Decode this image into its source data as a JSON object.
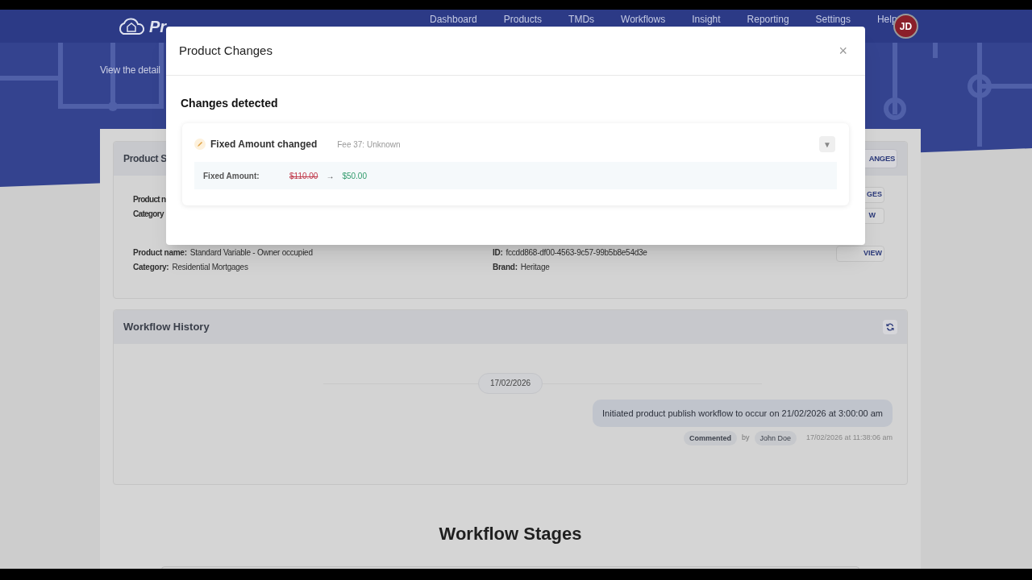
{
  "header": {
    "logo": "Pr",
    "nav": [
      "Dashboard",
      "Products",
      "TMDs",
      "Workflows",
      "Insight",
      "Reporting",
      "Settings",
      "Help"
    ],
    "avatar": "JD"
  },
  "hero": {
    "subtitle": "View the detail"
  },
  "product_card": {
    "title": "Product S",
    "header_button": "ANGES",
    "items": [
      {
        "fields_left": [
          {
            "label": "Product n"
          },
          {
            "label": "Category"
          }
        ],
        "buttons": [
          "GES",
          "W"
        ]
      },
      {
        "fields_left": [
          {
            "label": "Product name:",
            "value": "Standard Variable - Owner occupied"
          },
          {
            "label": "Category:",
            "value": "Residential Mortgages"
          }
        ],
        "fields_right": [
          {
            "label": "ID:",
            "value": "fccdd868-df00-4563-9c57-99b5b8e54d3e"
          },
          {
            "label": "Brand:",
            "value": "Heritage"
          }
        ],
        "buttons": [
          "VIEW"
        ]
      }
    ]
  },
  "workflow_history": {
    "title": "Workflow History",
    "date": "17/02/2026",
    "entries": [
      {
        "message": "Initiated product publish workflow to occur on 21/02/2026 at 3:00:00 am",
        "tag": "Commented",
        "by": "by",
        "user": "John Doe",
        "time": "17/02/2026 at 11:38:06 am"
      }
    ]
  },
  "workflow_stages": {
    "title": "Workflow Stages"
  },
  "modal": {
    "title": "Product Changes",
    "close": "×",
    "heading": "Changes detected",
    "changes": [
      {
        "title": "Fixed Amount changed",
        "meta": "Fee 37: Unknown",
        "toggle": "▼",
        "expanded": true,
        "details": [
          {
            "label": "Fixed Amount:",
            "old": "$110.00",
            "arrow": "→",
            "new": "$50.00"
          }
        ]
      }
    ]
  }
}
